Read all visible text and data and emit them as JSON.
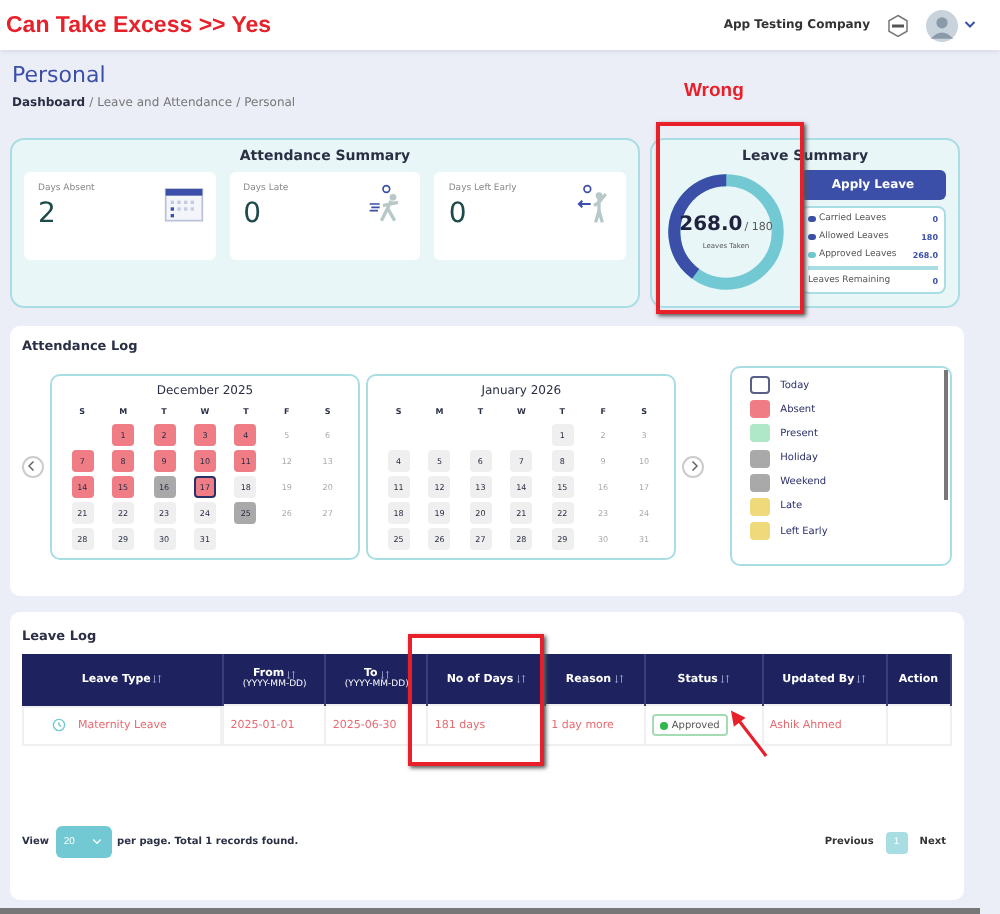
{
  "annotations": {
    "top_note": "Can Take Excess >> Yes",
    "wrong_note": "Wrong"
  },
  "header": {
    "company": "App Testing Company"
  },
  "page": {
    "title": "Personal",
    "breadcrumb": [
      {
        "label": "Dashboard",
        "kind": "link"
      },
      {
        "label": "/",
        "kind": "separator"
      },
      {
        "label": "Leave and Attendance",
        "kind": "current"
      },
      {
        "label": "/",
        "kind": "separator"
      },
      {
        "label": "Personal",
        "kind": "current"
      }
    ]
  },
  "attendance_summary": {
    "title": "Attendance Summary",
    "cards": [
      {
        "label": "Days Absent",
        "value": "2",
        "kind": "calendar"
      },
      {
        "label": "Days Late",
        "value": "0",
        "kind": "late"
      },
      {
        "label": "Days Left Early",
        "value": "0",
        "kind": "early"
      }
    ]
  },
  "leave_summary": {
    "title": "Leave Summary",
    "taken": "268.0",
    "total": "/ 180",
    "caption": "Leaves Taken",
    "level": 0.4,
    "apply_button": "Apply Leave",
    "items": [
      {
        "label": "Carried Leaves",
        "value": "0",
        "color": "#3b4fa8"
      },
      {
        "label": "Allowed Leaves",
        "value": "180",
        "color": "#3b4fa8"
      },
      {
        "label": "Approved Leaves",
        "value": "268.0",
        "color": "#6cc8d4"
      }
    ],
    "remaining": {
      "label": "Leaves Remaining",
      "value": "0"
    }
  },
  "attendance_log": {
    "title": "Attendance Log",
    "months": [
      {
        "title": "December 2025",
        "weekdays": [
          "S",
          "M",
          "T",
          "W",
          "T",
          "F",
          "S"
        ],
        "weeks": [
          [
            {
              "kind": "blank"
            },
            {
              "day": "1",
              "kind": "absent"
            },
            {
              "day": "2",
              "kind": "absent"
            },
            {
              "day": "3",
              "kind": "absent"
            },
            {
              "day": "4",
              "kind": "absent"
            },
            {
              "day": "5",
              "kind": "off"
            },
            {
              "day": "6",
              "kind": "off"
            }
          ],
          [
            {
              "day": "7",
              "kind": "absent"
            },
            {
              "day": "8",
              "kind": "absent"
            },
            {
              "day": "9",
              "kind": "absent"
            },
            {
              "day": "10",
              "kind": "absent"
            },
            {
              "day": "11",
              "kind": "absent"
            },
            {
              "day": "12",
              "kind": "off"
            },
            {
              "day": "13",
              "kind": "off"
            }
          ],
          [
            {
              "day": "14",
              "kind": "absent"
            },
            {
              "day": "15",
              "kind": "absent"
            },
            {
              "day": "16",
              "kind": "holiday"
            },
            {
              "day": "17",
              "kind": "today"
            },
            {
              "day": "18",
              "kind": "workday"
            },
            {
              "day": "19",
              "kind": "off"
            },
            {
              "day": "20",
              "kind": "off"
            }
          ],
          [
            {
              "day": "21",
              "kind": "workday"
            },
            {
              "day": "22",
              "kind": "workday"
            },
            {
              "day": "23",
              "kind": "workday"
            },
            {
              "day": "24",
              "kind": "workday"
            },
            {
              "day": "25",
              "kind": "holiday"
            },
            {
              "day": "26",
              "kind": "off"
            },
            {
              "day": "27",
              "kind": "off"
            }
          ],
          [
            {
              "day": "28",
              "kind": "workday"
            },
            {
              "day": "29",
              "kind": "workday"
            },
            {
              "day": "30",
              "kind": "workday"
            },
            {
              "day": "31",
              "kind": "workday"
            }
          ]
        ]
      },
      {
        "title": "January 2026",
        "weekdays": [
          "S",
          "M",
          "T",
          "W",
          "T",
          "F",
          "S"
        ],
        "weeks": [
          [
            {
              "kind": "blank"
            },
            {
              "kind": "blank"
            },
            {
              "kind": "blank"
            },
            {
              "kind": "blank"
            },
            {
              "day": "1",
              "kind": "workday"
            },
            {
              "day": "2",
              "kind": "off"
            },
            {
              "day": "3",
              "kind": "off"
            }
          ],
          [
            {
              "day": "4",
              "kind": "workday"
            },
            {
              "day": "5",
              "kind": "workday"
            },
            {
              "day": "6",
              "kind": "workday"
            },
            {
              "day": "7",
              "kind": "workday"
            },
            {
              "day": "8",
              "kind": "workday"
            },
            {
              "day": "9",
              "kind": "off"
            },
            {
              "day": "10",
              "kind": "off"
            }
          ],
          [
            {
              "day": "11",
              "kind": "workday"
            },
            {
              "day": "12",
              "kind": "workday"
            },
            {
              "day": "13",
              "kind": "workday"
            },
            {
              "day": "14",
              "kind": "workday"
            },
            {
              "day": "15",
              "kind": "workday"
            },
            {
              "day": "16",
              "kind": "off"
            },
            {
              "day": "17",
              "kind": "off"
            }
          ],
          [
            {
              "day": "18",
              "kind": "workday"
            },
            {
              "day": "19",
              "kind": "workday"
            },
            {
              "day": "20",
              "kind": "workday"
            },
            {
              "day": "21",
              "kind": "workday"
            },
            {
              "day": "22",
              "kind": "workday"
            },
            {
              "day": "23",
              "kind": "off"
            },
            {
              "day": "24",
              "kind": "off"
            }
          ],
          [
            {
              "day": "25",
              "kind": "workday"
            },
            {
              "day": "26",
              "kind": "workday"
            },
            {
              "day": "27",
              "kind": "workday"
            },
            {
              "day": "28",
              "kind": "workday"
            },
            {
              "day": "29",
              "kind": "workday"
            },
            {
              "day": "30",
              "kind": "off"
            },
            {
              "day": "31",
              "kind": "off"
            }
          ]
        ]
      }
    ],
    "legend": [
      {
        "label": "Today",
        "kind": "outline",
        "color": "#5a5f8a"
      },
      {
        "label": "Absent",
        "kind": "fill",
        "color": "#f07c85"
      },
      {
        "label": "Present",
        "kind": "fill",
        "color": "#aee8c8"
      },
      {
        "label": "Holiday",
        "kind": "fill",
        "color": "#a9a9a9"
      },
      {
        "label": "Weekend",
        "kind": "fill",
        "color": "#a9a9a9"
      },
      {
        "label": "Late",
        "kind": "fill",
        "color": "#f0d97a"
      },
      {
        "label": "Left Early",
        "kind": "fill",
        "color": "#f0d97a"
      }
    ]
  },
  "leave_log": {
    "title": "Leave Log",
    "columns": [
      {
        "label": "Leave Type",
        "sortable": true
      },
      {
        "label": "From",
        "sub": "(YYYY-MM-DD)",
        "sortable": true
      },
      {
        "label": "To",
        "sub": "(YYYY-MM-DD)",
        "sortable": true
      },
      {
        "label": "No of Days",
        "sortable": true
      },
      {
        "label": "Reason",
        "sortable": true
      },
      {
        "label": "Status",
        "sortable": true
      },
      {
        "label": "Updated By",
        "sortable": true
      },
      {
        "label": "Action",
        "sortable": false
      }
    ],
    "rows": [
      {
        "leave_type": "Maternity Leave",
        "from": "2025-01-01",
        "to": "2025-06-30",
        "days": "181 days",
        "reason": "1 day more",
        "status": "Approved",
        "updated_by": "Ashik Ahmed"
      }
    ],
    "footer": {
      "view": "View",
      "page_size": "20",
      "summary": "per page. Total 1 records found.",
      "previous": "Previous",
      "pages": [
        {
          "label": "1",
          "selected": true
        }
      ],
      "next": "Next"
    }
  }
}
